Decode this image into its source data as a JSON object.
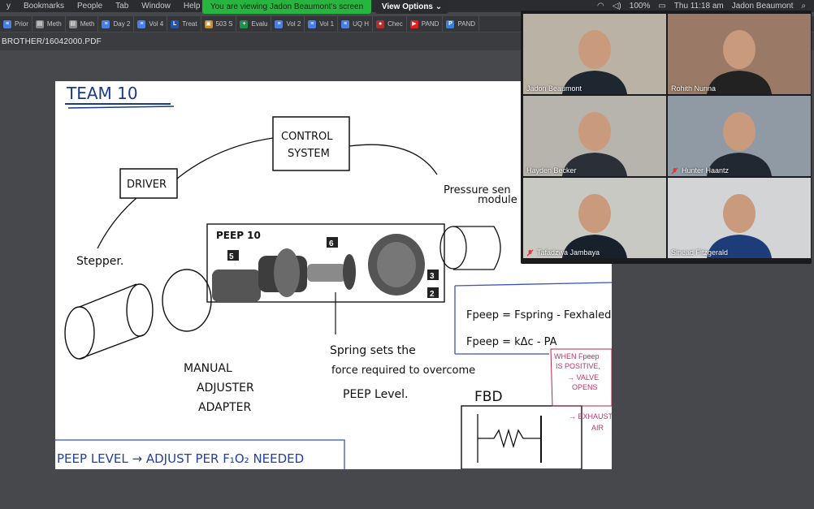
{
  "menubar": {
    "items": [
      "y",
      "Bookmarks",
      "People",
      "Tab",
      "Window",
      "Help"
    ],
    "battery": "100%",
    "clock": "Thu 11:18 am",
    "user": "Jadon Beaumont"
  },
  "share": {
    "banner": "You are viewing Jadon Beaumont's screen",
    "view_options": "View Options ⌄"
  },
  "bookmarks": [
    {
      "label": "Prior",
      "icon": "doc-icon",
      "color": "#4a7fe0"
    },
    {
      "label": "Meth",
      "icon": "page-icon",
      "color": "#888888"
    },
    {
      "label": "Meth",
      "icon": "page-icon",
      "color": "#888888"
    },
    {
      "label": "Day 2",
      "icon": "doc-icon",
      "color": "#4a7fe0"
    },
    {
      "label": "Vol 4",
      "icon": "doc-icon",
      "color": "#4a7fe0"
    },
    {
      "label": "Treat",
      "icon": "l-icon",
      "color": "#2255aa"
    },
    {
      "label": "503 S",
      "icon": "image-icon",
      "color": "#c28a2b"
    },
    {
      "label": "Evalu",
      "icon": "plus-icon",
      "color": "#1f8f4a"
    },
    {
      "label": "Vol 2",
      "icon": "doc-icon",
      "color": "#4a7fe0"
    },
    {
      "label": "Vol 1",
      "icon": "doc-icon",
      "color": "#4a7fe0"
    },
    {
      "label": "UQ H",
      "icon": "doc-icon",
      "color": "#4a7fe0"
    },
    {
      "label": "Chec",
      "icon": "circle-icon",
      "color": "#b03030"
    },
    {
      "label": "PAND",
      "icon": "youtube-icon",
      "color": "#e02020"
    },
    {
      "label": "PAND",
      "icon": "p-icon",
      "color": "#3a7fd5"
    }
  ],
  "path": "BROTHER/16042000.PDF",
  "drawing": {
    "team": "TEAM 10",
    "control": [
      "CONTROL",
      "SYSTEM"
    ],
    "driver": "DRIVER",
    "pressure": [
      "Pressure sen",
      "module"
    ],
    "peep_title": "PEEP 10",
    "callouts": [
      "5",
      "6",
      "3",
      "2"
    ],
    "stepper": "Stepper.",
    "manual": [
      "MANUAL",
      "ADJUSTER",
      "ADAPTER"
    ],
    "spring": [
      "Spring sets the",
      "force required to overcome",
      "PEEP Level."
    ],
    "eq1": "Fpeep = Fspring - Fexhaled air",
    "eq2": "Fpeep = kΔc - PA",
    "fbd": "FBD",
    "red_note": [
      "WHEN Fpeep",
      "IS POSITIVE,",
      "→ VALVE",
      "OPENS",
      "→ EXHAUST",
      "AIR"
    ],
    "bottom": "PEEP LEVEL → ADJUST PER F₁O₂ NEEDED"
  },
  "participants": [
    {
      "name": "Jadon Beaumont",
      "muted": false,
      "active": true,
      "bg": "#b9b2a5",
      "shirt": "#1e2630"
    },
    {
      "name": "Rohith Nunna",
      "muted": false,
      "active": false,
      "bg": "#9a7a66",
      "shirt": "#222222"
    },
    {
      "name": "Hayden Becker",
      "muted": false,
      "active": false,
      "bg": "#b7b3ad",
      "shirt": "#2a2f38"
    },
    {
      "name": "Hunter Haantz",
      "muted": true,
      "active": false,
      "bg": "#8f9aa5",
      "shirt": "#222831"
    },
    {
      "name": "Tafadzwa Jambaya",
      "muted": true,
      "active": false,
      "bg": "#c9c9c4",
      "shirt": "#18202c"
    },
    {
      "name": "Sinead Fitzgerald",
      "muted": false,
      "active": false,
      "bg": "#d2d4d6",
      "shirt": "#1d3d7a"
    }
  ]
}
